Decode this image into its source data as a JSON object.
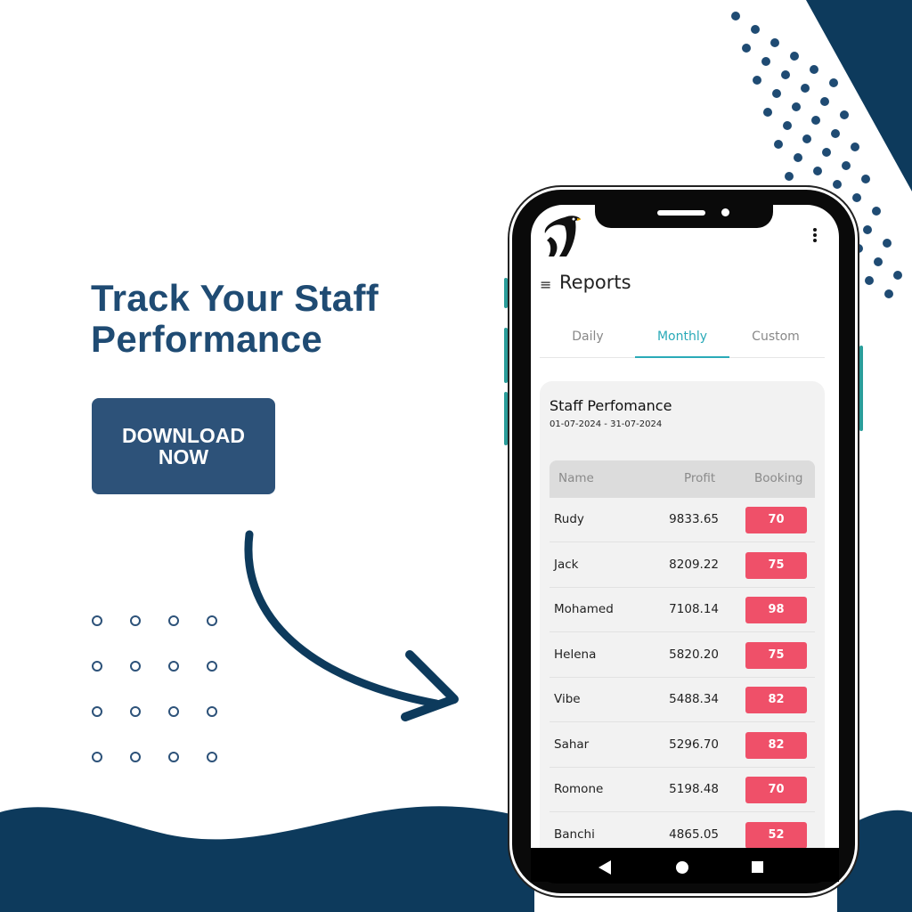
{
  "promo": {
    "headline_line1": "Track Your Staff",
    "headline_line2": "Performance",
    "cta_line1": "DOWNLOAD",
    "cta_line2": "NOW"
  },
  "colors": {
    "navy": "#0d3a5c",
    "accent": "#2aaab8",
    "badge": "#ef5069",
    "button": "#2d5279"
  },
  "app": {
    "title": "Reports",
    "menu_icon": "hamburger-icon",
    "more_icon": "vertical-dots-icon",
    "tabs": [
      {
        "label": "Daily"
      },
      {
        "label": "Monthly",
        "active": true
      },
      {
        "label": "Custom"
      }
    ],
    "card": {
      "title": "Staff Perfomance",
      "date_range": "01-07-2024 - 31-07-2024",
      "columns": [
        "Name",
        "Profit",
        "Booking"
      ],
      "rows": [
        {
          "name": "Rudy",
          "profit": "9833.65",
          "booking": "70"
        },
        {
          "name": "Jack",
          "profit": "8209.22",
          "booking": "75"
        },
        {
          "name": "Mohamed",
          "profit": "7108.14",
          "booking": "98"
        },
        {
          "name": "Helena",
          "profit": "5820.20",
          "booking": "75"
        },
        {
          "name": "Vibe",
          "profit": "5488.34",
          "booking": "82"
        },
        {
          "name": "Sahar",
          "profit": "5296.70",
          "booking": "82"
        },
        {
          "name": "Romone",
          "profit": "5198.48",
          "booking": "70"
        },
        {
          "name": "Banchi",
          "profit": "4865.05",
          "booking": "52"
        }
      ]
    }
  },
  "navbar": {
    "icons": [
      "back-icon",
      "home-icon",
      "recents-icon"
    ]
  }
}
